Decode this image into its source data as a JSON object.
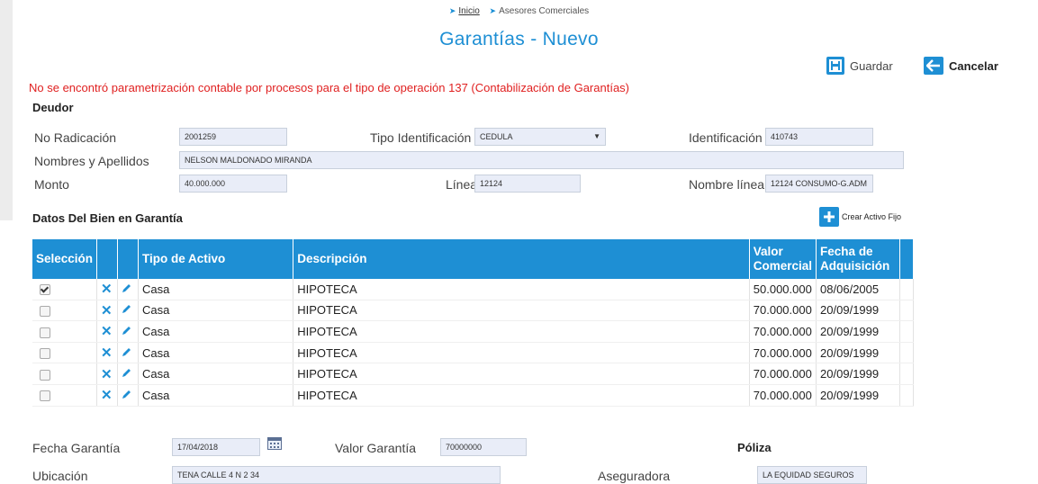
{
  "breadcrumb": {
    "home": "Inicio",
    "current": "Asesores Comerciales"
  },
  "page_title": "Garantías - Nuevo",
  "actions": {
    "save": "Guardar",
    "cancel": "Cancelar",
    "create_asset": "Crear Activo Fijo"
  },
  "error_message": "No se encontró parametrización contable por procesos para el tipo de operación 137 (Contabilización de Garantías)",
  "deudor": {
    "section": "Deudor",
    "no_radicacion_label": "No Radicación",
    "no_radicacion": "2001259",
    "tipo_id_label": "Tipo Identificación",
    "tipo_id": "CEDULA",
    "identificacion_label": "Identificación",
    "identificacion": "410743",
    "nombres_label": "Nombres y Apellidos",
    "nombres": "NELSON  MALDONADO MIRANDA",
    "monto_label": "Monto",
    "monto": "40.000.000",
    "linea_label": "Línea",
    "linea": "12124",
    "nombre_linea_label": "Nombre línea",
    "nombre_linea": "12124 CONSUMO-G.ADM"
  },
  "bien": {
    "section": "Datos Del Bien en Garantía",
    "columns": {
      "seleccion": "Selección",
      "tipo": "Tipo de Activo",
      "descripcion": "Descripción",
      "valor": "Valor Comercial",
      "fecha": "Fecha de Adquisición"
    },
    "rows": [
      {
        "checked": true,
        "tipo": "Casa",
        "descripcion": "HIPOTECA",
        "valor": "50.000.000",
        "fecha": "08/06/2005"
      },
      {
        "checked": false,
        "tipo": "Casa",
        "descripcion": "HIPOTECA",
        "valor": "70.000.000",
        "fecha": "20/09/1999"
      },
      {
        "checked": false,
        "tipo": "Casa",
        "descripcion": "HIPOTECA",
        "valor": "70.000.000",
        "fecha": "20/09/1999"
      },
      {
        "checked": false,
        "tipo": "Casa",
        "descripcion": "HIPOTECA",
        "valor": "70.000.000",
        "fecha": "20/09/1999"
      },
      {
        "checked": false,
        "tipo": "Casa",
        "descripcion": "HIPOTECA",
        "valor": "70.000.000",
        "fecha": "20/09/1999"
      },
      {
        "checked": false,
        "tipo": "Casa",
        "descripcion": "HIPOTECA",
        "valor": "70.000.000",
        "fecha": "20/09/1999"
      }
    ]
  },
  "garantia": {
    "fecha_label": "Fecha Garantía",
    "fecha": "17/04/2018",
    "valor_label": "Valor Garantía",
    "valor": "70000000",
    "poliza_label": "Póliza",
    "ubicacion_label": "Ubicación",
    "ubicacion": "TENA CALLE 4 N 2 34",
    "aseguradora_label": "Aseguradora",
    "aseguradora": "LA EQUIDAD SEGUROS"
  },
  "icons": [
    "save-icon",
    "back-arrow-icon",
    "plus-icon",
    "delete-x-icon",
    "edit-pencil-icon",
    "calendar-icon",
    "chevron-down-icon"
  ],
  "colors": {
    "accent": "#1e8fd4",
    "error": "#e02020",
    "input_bg": "#e9edf8"
  }
}
